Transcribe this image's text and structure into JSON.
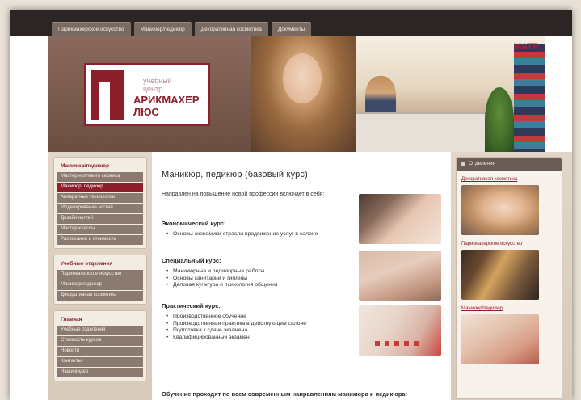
{
  "nav": {
    "tabs": [
      {
        "label": "Парикмахерское искусство"
      },
      {
        "label": "Маникюр/педикюр"
      },
      {
        "label": "Декоративная косметика"
      },
      {
        "label": "Документы"
      }
    ]
  },
  "banner": {
    "logo_sub_line1": "учебный",
    "logo_sub_line2": "центр",
    "logo_main_line1": "АРИКМАХЕР",
    "logo_main_line2": "ЛЮС",
    "salon_sign": "MATR"
  },
  "sidebar": {
    "groups": [
      {
        "title": "Маникюр/педикюр",
        "items": [
          {
            "label": "Мастер ногтевого сервиса"
          },
          {
            "label": "Маникюр, педикюр"
          },
          {
            "label": "Аппаратные технологии"
          },
          {
            "label": "Моделирование ногтей"
          },
          {
            "label": "Дизайн ногтей"
          },
          {
            "label": "Мастер классы"
          },
          {
            "label": "Расписание и стоимость"
          }
        ]
      },
      {
        "title": "Учебные отделения",
        "items": [
          {
            "label": "Парикмахерское искусство"
          },
          {
            "label": "Маникюр/педикюр"
          },
          {
            "label": "Декоративная косметика"
          }
        ]
      },
      {
        "title": "Главная",
        "items": [
          {
            "label": "Учебные отделения"
          },
          {
            "label": "Стоимость курсов"
          },
          {
            "label": "Новости"
          },
          {
            "label": "Контакты"
          },
          {
            "label": "Наши видео"
          }
        ]
      }
    ]
  },
  "content": {
    "title": "Маникюр, педикюр (базовый курс)",
    "intro": "Направлен на повышение новой профессии включает в себя:",
    "sections": [
      {
        "heading": "Экономический курс:",
        "items": [
          "Основы экономики отрасли продвижение услуг в салоне"
        ]
      },
      {
        "heading": "Специальный курс:",
        "items": [
          "Маникюрные и педикюрные работы",
          "Основы санитарии и гигиены",
          "Деловая культура и психология общения"
        ]
      },
      {
        "heading": "Практический курс:",
        "items": [
          "Производственное обучение",
          "Производственная практика в действующем салоне",
          "Подготовка к сдаче экзамена",
          "Квалифицированный экзамен"
        ]
      }
    ],
    "footer_text": "Обучение проходят по всем современным направлениям маникюра и педикюра:"
  },
  "right": {
    "header": "Отделения",
    "links": [
      {
        "label": "Декоративная косметика"
      },
      {
        "label": "Парикмахерское искусство"
      },
      {
        "label": "Маникюр/педикюр"
      }
    ]
  }
}
